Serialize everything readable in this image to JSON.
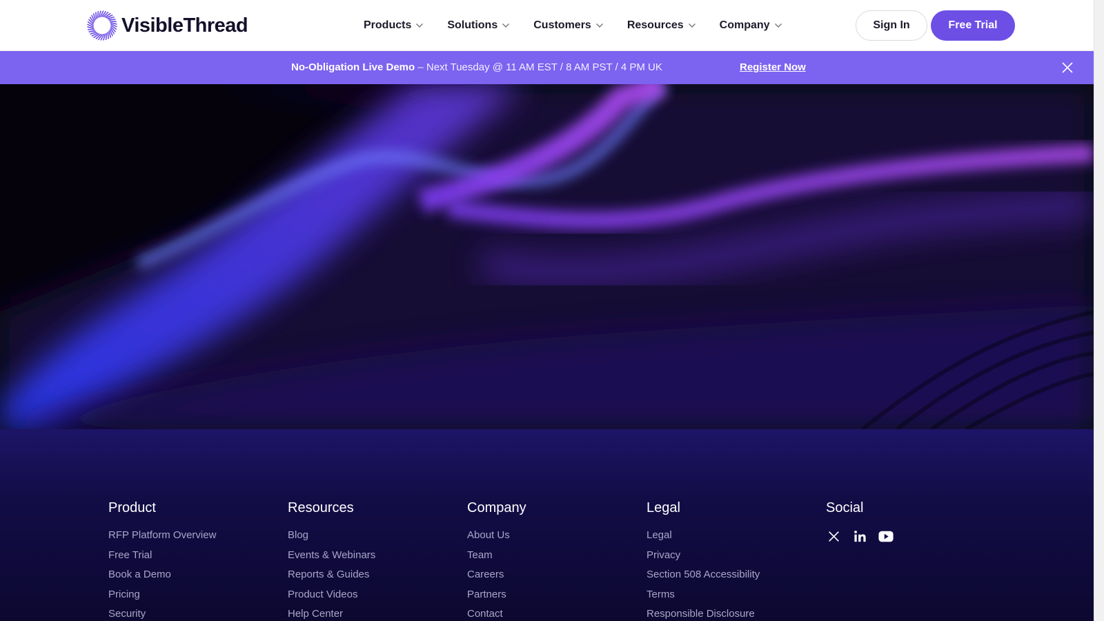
{
  "brand": {
    "name": "VisibleThread",
    "accent": "#6d4fe6"
  },
  "nav": {
    "items": [
      {
        "label": "Products"
      },
      {
        "label": "Solutions"
      },
      {
        "label": "Customers"
      },
      {
        "label": "Resources"
      },
      {
        "label": "Company"
      }
    ],
    "sign_in": "Sign In",
    "free_trial": "Free Trial"
  },
  "banner": {
    "bold": "No-Obligation Live Demo",
    "rest": " – Next Tuesday @ 11 AM EST / 8 AM PST / 4 PM UK",
    "link": "Register Now",
    "close_icon": "close-icon",
    "color": "#7c63f0"
  },
  "footer": {
    "columns": [
      {
        "title": "Product",
        "links": [
          "RFP Platform Overview",
          "Free Trial",
          "Book a Demo",
          "Pricing",
          "Security"
        ]
      },
      {
        "title": "Resources",
        "links": [
          "Blog",
          "Events & Webinars",
          "Reports & Guides",
          "Product Videos",
          "Help Center"
        ]
      },
      {
        "title": "Company",
        "links": [
          "About Us",
          "Team",
          "Careers",
          "Partners",
          "Contact"
        ]
      },
      {
        "title": "Legal",
        "links": [
          "Legal",
          "Privacy",
          "Section 508 Accessibility",
          "Terms",
          "Responsible Disclosure"
        ]
      },
      {
        "title": "Social",
        "icons": [
          "x-icon",
          "linkedin-icon",
          "youtube-icon"
        ]
      }
    ]
  }
}
